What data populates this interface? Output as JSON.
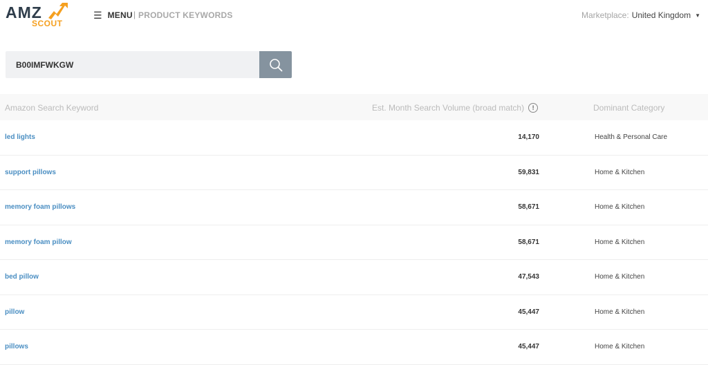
{
  "brand": {
    "line1": "AMZ",
    "line2": "SCOUT",
    "accent": "#f5a020"
  },
  "header": {
    "menu_label": "MENU",
    "separator": "|",
    "breadcrumb": "PRODUCT KEYWORDS",
    "marketplace_label": "Marketplace:",
    "marketplace_value": "United Kingdom"
  },
  "search": {
    "value": "B00IMFWKGW"
  },
  "table": {
    "columns": {
      "keyword": "Amazon Search Keyword",
      "volume": "Est. Month Search Volume (broad match)",
      "category": "Dominant Category"
    },
    "rows": [
      {
        "keyword": "led lights",
        "volume": "14,170",
        "category": "Health & Personal Care"
      },
      {
        "keyword": "support pillows",
        "volume": "59,831",
        "category": "Home & Kitchen"
      },
      {
        "keyword": "memory foam pillows",
        "volume": "58,671",
        "category": "Home & Kitchen"
      },
      {
        "keyword": "memory foam pillow",
        "volume": "58,671",
        "category": "Home & Kitchen"
      },
      {
        "keyword": "bed pillow",
        "volume": "47,543",
        "category": "Home & Kitchen"
      },
      {
        "keyword": "pillow",
        "volume": "45,447",
        "category": "Home & Kitchen"
      },
      {
        "keyword": "pillows",
        "volume": "45,447",
        "category": "Home & Kitchen"
      }
    ]
  }
}
